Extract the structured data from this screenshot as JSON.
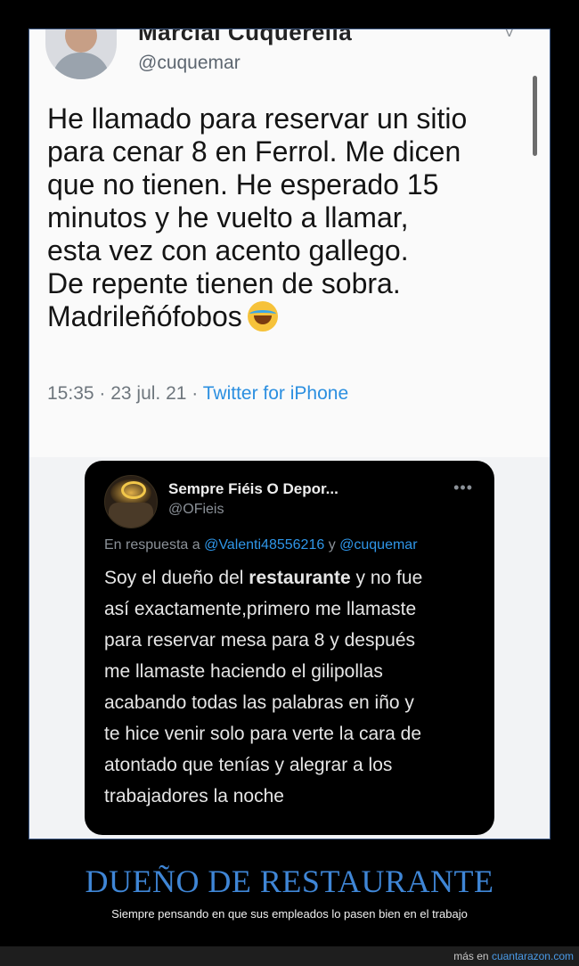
{
  "main_tweet": {
    "display_name": "Marcial Cuquerella",
    "handle": "@cuquemar",
    "text_lines": [
      "He llamado para reservar un sitio",
      "para cenar 8 en Ferrol. Me dicen",
      "que no tienen. He esperado 15",
      "minutos y he vuelto a llamar,",
      "esta vez con acento gallego.",
      "De repente tienen de sobra.",
      "Madrileñófobos"
    ],
    "emoji": "laughing-tears-emoji",
    "time_date": "15:35 · 23 jul. 21 · ",
    "source": "Twitter for iPhone"
  },
  "reply_tweet": {
    "display_name": "Sempre Fiéis O Depor...",
    "handle": "@OFieis",
    "in_reply_prefix": "En respuesta a ",
    "mention_1": "@Valenti48556216",
    "connector": " y ",
    "mention_2": "@cuquemar",
    "line1_before": "Soy el dueño del ",
    "line1_bold": "restaurante",
    "line1_after": " y no fue",
    "text_lines": [
      "así exactamente,primero me llamaste",
      "para reservar mesa para 8 y después",
      "me llamaste haciendo el gilipollas",
      "acabando todas las palabras en iño y",
      "te hice venir solo para verte la cara de",
      "atontado que tenías y alegrar a los",
      "trabajadores la noche"
    ]
  },
  "caption": {
    "title": "DUEÑO DE RESTAURANTE",
    "subtitle": "Siempre pensando en que sus empleados lo pasen bien en el trabajo"
  },
  "footer": {
    "prefix": "más en ",
    "site": "cuantarazon.com"
  },
  "colors": {
    "accent": "#3f86d6",
    "link": "#2b8fe0",
    "reply_bg": "#000000"
  }
}
